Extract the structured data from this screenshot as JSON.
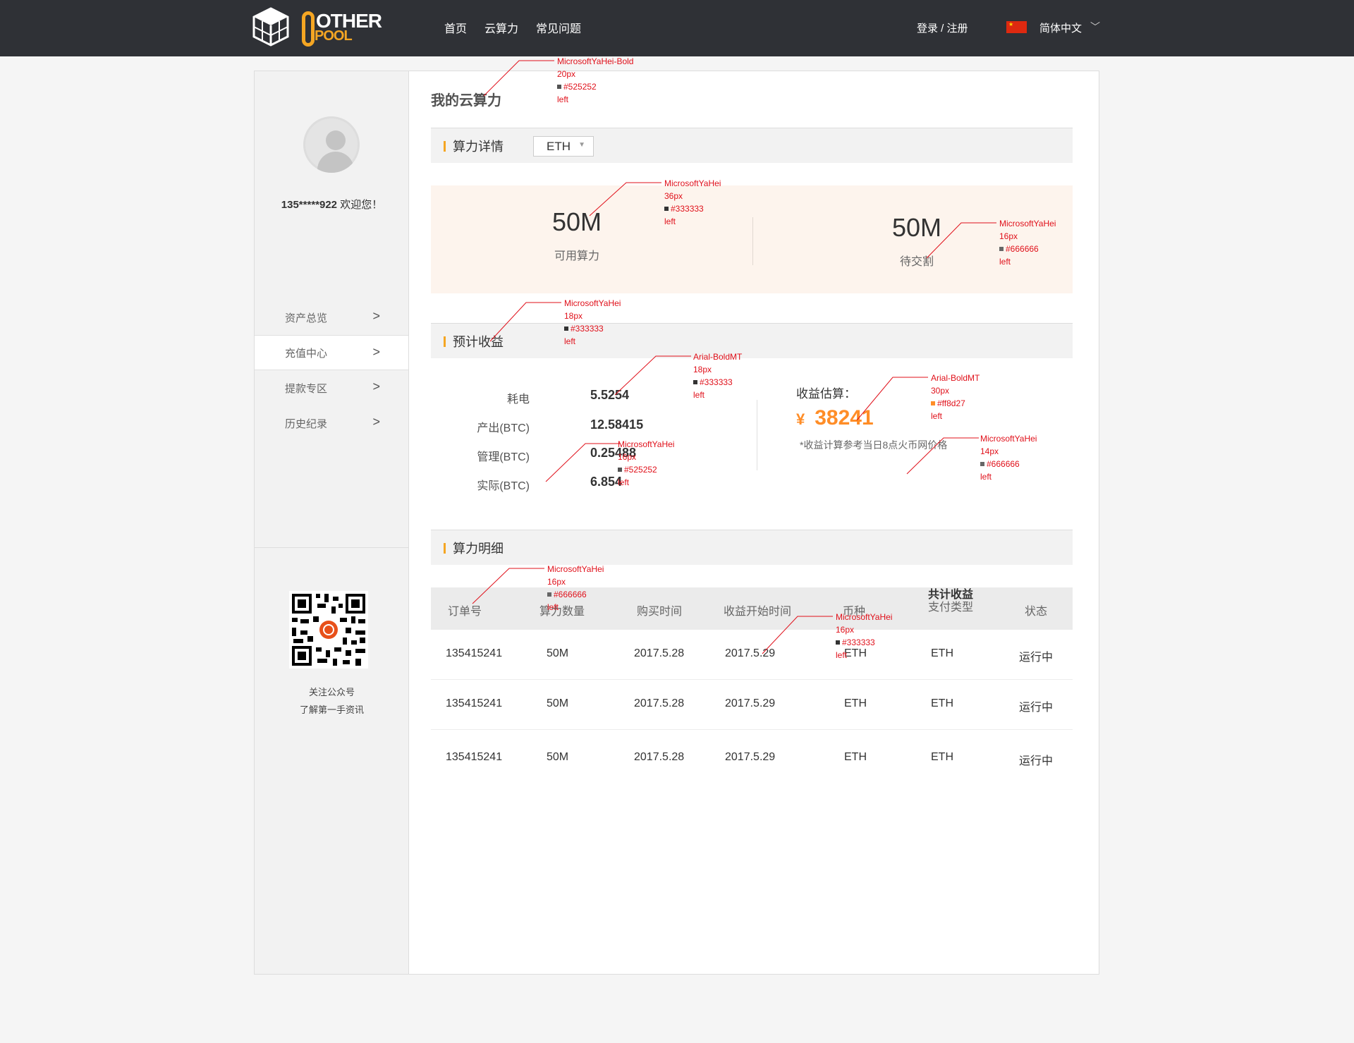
{
  "header": {
    "logo_top": "OTHER",
    "logo_bottom": "POOL",
    "nav": [
      "首页",
      "云算力",
      "常见问题"
    ],
    "login": "登录 / 注册",
    "language": "简体中文"
  },
  "sidebar": {
    "user": "135*****922",
    "welcome": " 欢迎您！",
    "menu": [
      "资产总览",
      "充值中心",
      "提款专区",
      "历史纪录"
    ],
    "active_index": 1,
    "qr_line1": "关注公众号",
    "qr_line2": "了解第一手资讯"
  },
  "main": {
    "title": "我的云算力",
    "power_section": {
      "label": "算力详情",
      "coin": "ETH",
      "available_value": "50M",
      "available_label": "可用算力",
      "pending_value": "50M",
      "pending_label": "待交割"
    },
    "income_section": {
      "label": "预计收益",
      "rows": [
        {
          "key": "耗电",
          "value": "5.5254"
        },
        {
          "key": "产出(BTC)",
          "value": "12.58415"
        },
        {
          "key": "管理(BTC)",
          "value": "0.25488"
        },
        {
          "key": "实际(BTC)",
          "value": "6.854"
        }
      ],
      "estimate_label": "收益估算：",
      "currency": "¥",
      "estimate_value": "38241",
      "note": "*收益计算参考当日8点火币网价格"
    },
    "detail_section": {
      "label": "算力明细",
      "headers": [
        "订单号",
        "算力数量",
        "购买时间",
        "收益开始时间",
        "币种",
        "共计收益",
        "支付类型",
        "状态"
      ],
      "rows": [
        [
          "135415241",
          "50M",
          "2017.5.28",
          "2017.5.29",
          "ETH",
          "ETH",
          "运行中"
        ],
        [
          "135415241",
          "50M",
          "2017.5.28",
          "2017.5.29",
          "ETH",
          "ETH",
          "运行中"
        ],
        [
          "135415241",
          "50M",
          "2017.5.28",
          "2017.5.29",
          "ETH",
          "ETH",
          "运行中"
        ]
      ]
    }
  },
  "annotations": [
    {
      "font": "MicrosoftYaHei-Bold",
      "size": "20px",
      "color": "#525252",
      "align": "left"
    },
    {
      "font": "MicrosoftYaHei",
      "size": "36px",
      "color": "#333333",
      "align": "left"
    },
    {
      "font": "MicrosoftYaHei",
      "size": "16px",
      "color": "#666666",
      "align": "left"
    },
    {
      "font": "MicrosoftYaHei",
      "size": "18px",
      "color": "#333333",
      "align": "left"
    },
    {
      "font": "Arial-BoldMT",
      "size": "18px",
      "color": "#333333",
      "align": "left"
    },
    {
      "font": "Arial-BoldMT",
      "size": "30px",
      "color": "#ff8d27",
      "align": "left"
    },
    {
      "font": "MicrosoftYaHei",
      "size": "16px",
      "color": "#525252",
      "align": "left"
    },
    {
      "font": "MicrosoftYaHei",
      "size": "14px",
      "color": "#666666",
      "align": "left"
    },
    {
      "font": "MicrosoftYaHei",
      "size": "16px",
      "color": "#666666",
      "align": "left"
    },
    {
      "font": "MicrosoftYaHei",
      "size": "16px",
      "color": "#333333",
      "align": "left"
    }
  ],
  "colors": {
    "accent": "#f5a623",
    "header_bg": "#2f3136",
    "estimate": "#ff8d27",
    "annotation": "#e0101a"
  }
}
